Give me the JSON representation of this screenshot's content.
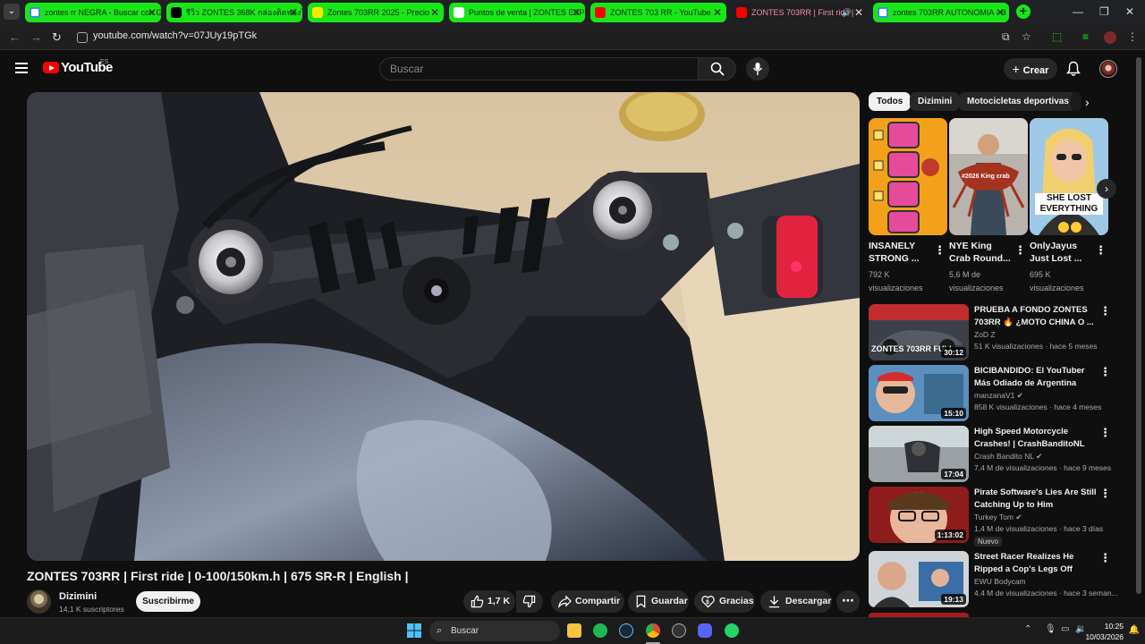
{
  "browser": {
    "tabs": [
      {
        "label": "zontes rr NEGRA - Buscar con Google",
        "favicon_color": "#4285f4"
      },
      {
        "label": "รีวิว ZONTES 368K กล่องติดหลังใจดี",
        "favicon_color": "#000000"
      },
      {
        "label": "Zontes 703RR 2025 - Precio",
        "favicon_color": "#ffe600"
      },
      {
        "label": "Puntos de venta | ZONTES ESP",
        "favicon_color": "#ffffff"
      },
      {
        "label": "ZONTES 703 RR - YouTube",
        "favicon_color": "#ff0000"
      },
      {
        "label": "ZONTES 703RR | First ride |",
        "favicon_color": "#ff0000"
      },
      {
        "label": "zontes 703RR AUTONOMIA - B",
        "favicon_color": "#4285f4"
      }
    ],
    "url": "youtube.com/watch?v=07JUy19pTGk"
  },
  "youtube": {
    "logo_text": "YouTube",
    "country_code": "ES",
    "search_placeholder": "Buscar",
    "create_label": "Crear"
  },
  "video": {
    "title": "ZONTES 703RR | First ride | 0-100/150km.h | 675 SR-R | English |",
    "channel": "Dizimini",
    "subscribers": "14,1 K suscriptores",
    "subscribe_label": "Suscribirme",
    "likes": "1,7 K",
    "share_label": "Compartir",
    "save_label": "Guardar",
    "thanks_label": "Gracias",
    "download_label": "Descargar"
  },
  "sidebar": {
    "chips": [
      "Todos",
      "Dizimini",
      "Motocicletas deportivas"
    ],
    "shorts": [
      {
        "title": "INSANELY STRONG ...",
        "views": "792 K visualizaciones"
      },
      {
        "title": "NYE King Crab Round...",
        "views": "5,6 M de visualizaciones",
        "overlay": "#2026 King crab"
      },
      {
        "title": "OnlyJayus Just Lost ...",
        "views": "695 K visualizaciones",
        "overlay": "SHE LOST EVERYTHING"
      }
    ],
    "videos": [
      {
        "title": "PRUEBA A FONDO ZONTES 703RR 🔥 ¿MOTO CHINA O ...",
        "channel": "ZoD Z",
        "meta": "51 K visualizaciones · hace 5 meses",
        "duration": "30:12",
        "thumb_text": "ZONTES 703RR FULL"
      },
      {
        "title": "BICIBANDIDO: El YouTuber Más Odiado de Argentina",
        "channel": "manzanaV1",
        "meta": "858 K visualizaciones · hace 4 meses",
        "duration": "15:10",
        "verified": true
      },
      {
        "title": "High Speed Motorcycle Crashes! | CrashBanditoNL",
        "channel": "Crash Bandito NL",
        "meta": "7,4 M de visualizaciones · hace 9 meses",
        "duration": "17:04",
        "verified": true
      },
      {
        "title": "Pirate Software's Lies Are Still Catching Up to Him",
        "channel": "Turkey Tom",
        "meta": "1,4 M de visualizaciones · hace 3 días",
        "duration": "1:13:02",
        "verified": true,
        "badge": "Nuevo"
      },
      {
        "title": "Street Racer Realizes He Ripped a Cop's Legs Off",
        "channel": "EWU Bodycam",
        "meta": "4,4 M de visualizaciones · hace 3 seman...",
        "duration": "19:13"
      }
    ]
  },
  "taskbar": {
    "search_label": "Buscar",
    "time": "10:25",
    "date": "10/03/2026"
  }
}
